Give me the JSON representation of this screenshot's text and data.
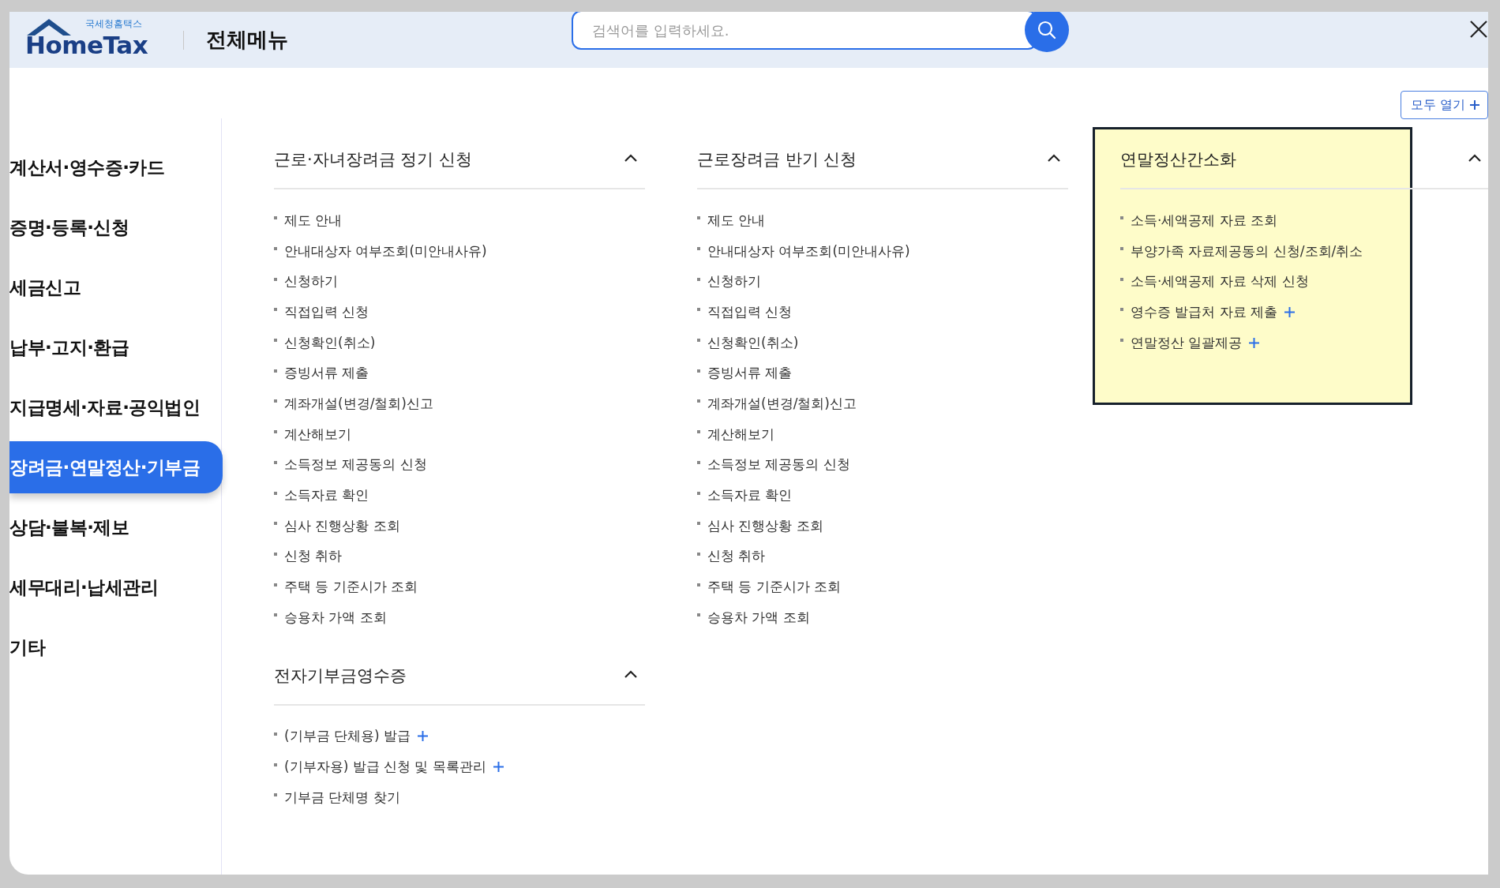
{
  "header": {
    "logo_caption": "국세청홈택스",
    "logo_name": "HomeTax",
    "title": "전체메뉴",
    "search": {
      "placeholder": "검색어를 입력하세요."
    }
  },
  "expand_all": "모두 열기",
  "sidebar": {
    "items": [
      {
        "label": "계산서·영수증·카드",
        "selected": false
      },
      {
        "label": "증명·등록·신청",
        "selected": false
      },
      {
        "label": "세금신고",
        "selected": false
      },
      {
        "label": "납부·고지·환급",
        "selected": false
      },
      {
        "label": "지급명세·자료·공익법인",
        "selected": false
      },
      {
        "label": "장려금·연말정산·기부금",
        "selected": true
      },
      {
        "label": "상담·불복·제보",
        "selected": false
      },
      {
        "label": "세무대리·납세관리",
        "selected": false
      },
      {
        "label": "기타",
        "selected": false
      }
    ]
  },
  "columns": [
    {
      "groups": [
        {
          "title": "근로·자녀장려금 정기 신청",
          "expanded": true,
          "highlighted": false,
          "items": [
            {
              "label": "제도 안내",
              "expandable": false
            },
            {
              "label": "안내대상자 여부조회(미안내사유)",
              "expandable": false
            },
            {
              "label": "신청하기",
              "expandable": false
            },
            {
              "label": "직접입력 신청",
              "expandable": false
            },
            {
              "label": "신청확인(취소)",
              "expandable": false
            },
            {
              "label": "증빙서류 제출",
              "expandable": false
            },
            {
              "label": "계좌개설(변경/철회)신고",
              "expandable": false
            },
            {
              "label": "계산해보기",
              "expandable": false
            },
            {
              "label": "소득정보 제공동의 신청",
              "expandable": false
            },
            {
              "label": "소득자료 확인",
              "expandable": false
            },
            {
              "label": "심사 진행상황 조회",
              "expandable": false
            },
            {
              "label": "신청 취하",
              "expandable": false
            },
            {
              "label": "주택 등 기준시가 조회",
              "expandable": false
            },
            {
              "label": "승용차 가액 조회",
              "expandable": false
            }
          ]
        },
        {
          "title": "전자기부금영수증",
          "expanded": true,
          "highlighted": false,
          "items": [
            {
              "label": "(기부금 단체용) 발급",
              "expandable": true
            },
            {
              "label": "(기부자용) 발급 신청 및 목록관리",
              "expandable": true
            },
            {
              "label": "기부금 단체명 찾기",
              "expandable": false
            }
          ]
        }
      ]
    },
    {
      "groups": [
        {
          "title": "근로장려금 반기 신청",
          "expanded": true,
          "highlighted": false,
          "items": [
            {
              "label": "제도 안내",
              "expandable": false
            },
            {
              "label": "안내대상자 여부조회(미안내사유)",
              "expandable": false
            },
            {
              "label": "신청하기",
              "expandable": false
            },
            {
              "label": "직접입력 신청",
              "expandable": false
            },
            {
              "label": "신청확인(취소)",
              "expandable": false
            },
            {
              "label": "증빙서류 제출",
              "expandable": false
            },
            {
              "label": "계좌개설(변경/철회)신고",
              "expandable": false
            },
            {
              "label": "계산해보기",
              "expandable": false
            },
            {
              "label": "소득정보 제공동의 신청",
              "expandable": false
            },
            {
              "label": "소득자료 확인",
              "expandable": false
            },
            {
              "label": "심사 진행상황 조회",
              "expandable": false
            },
            {
              "label": "신청 취하",
              "expandable": false
            },
            {
              "label": "주택 등 기준시가 조회",
              "expandable": false
            },
            {
              "label": "승용차 가액 조회",
              "expandable": false
            }
          ]
        }
      ]
    },
    {
      "groups": [
        {
          "title": "연말정산간소화",
          "expanded": true,
          "highlighted": true,
          "items": [
            {
              "label": "소득·세액공제 자료 조회",
              "expandable": false
            },
            {
              "label": "부양가족 자료제공동의 신청/조회/취소",
              "expandable": false
            },
            {
              "label": "소득·세액공제 자료 삭제 신청",
              "expandable": false
            },
            {
              "label": "영수증 발급처 자료 제출",
              "expandable": true
            },
            {
              "label": "연말정산 일괄제공",
              "expandable": true
            }
          ]
        }
      ]
    }
  ]
}
